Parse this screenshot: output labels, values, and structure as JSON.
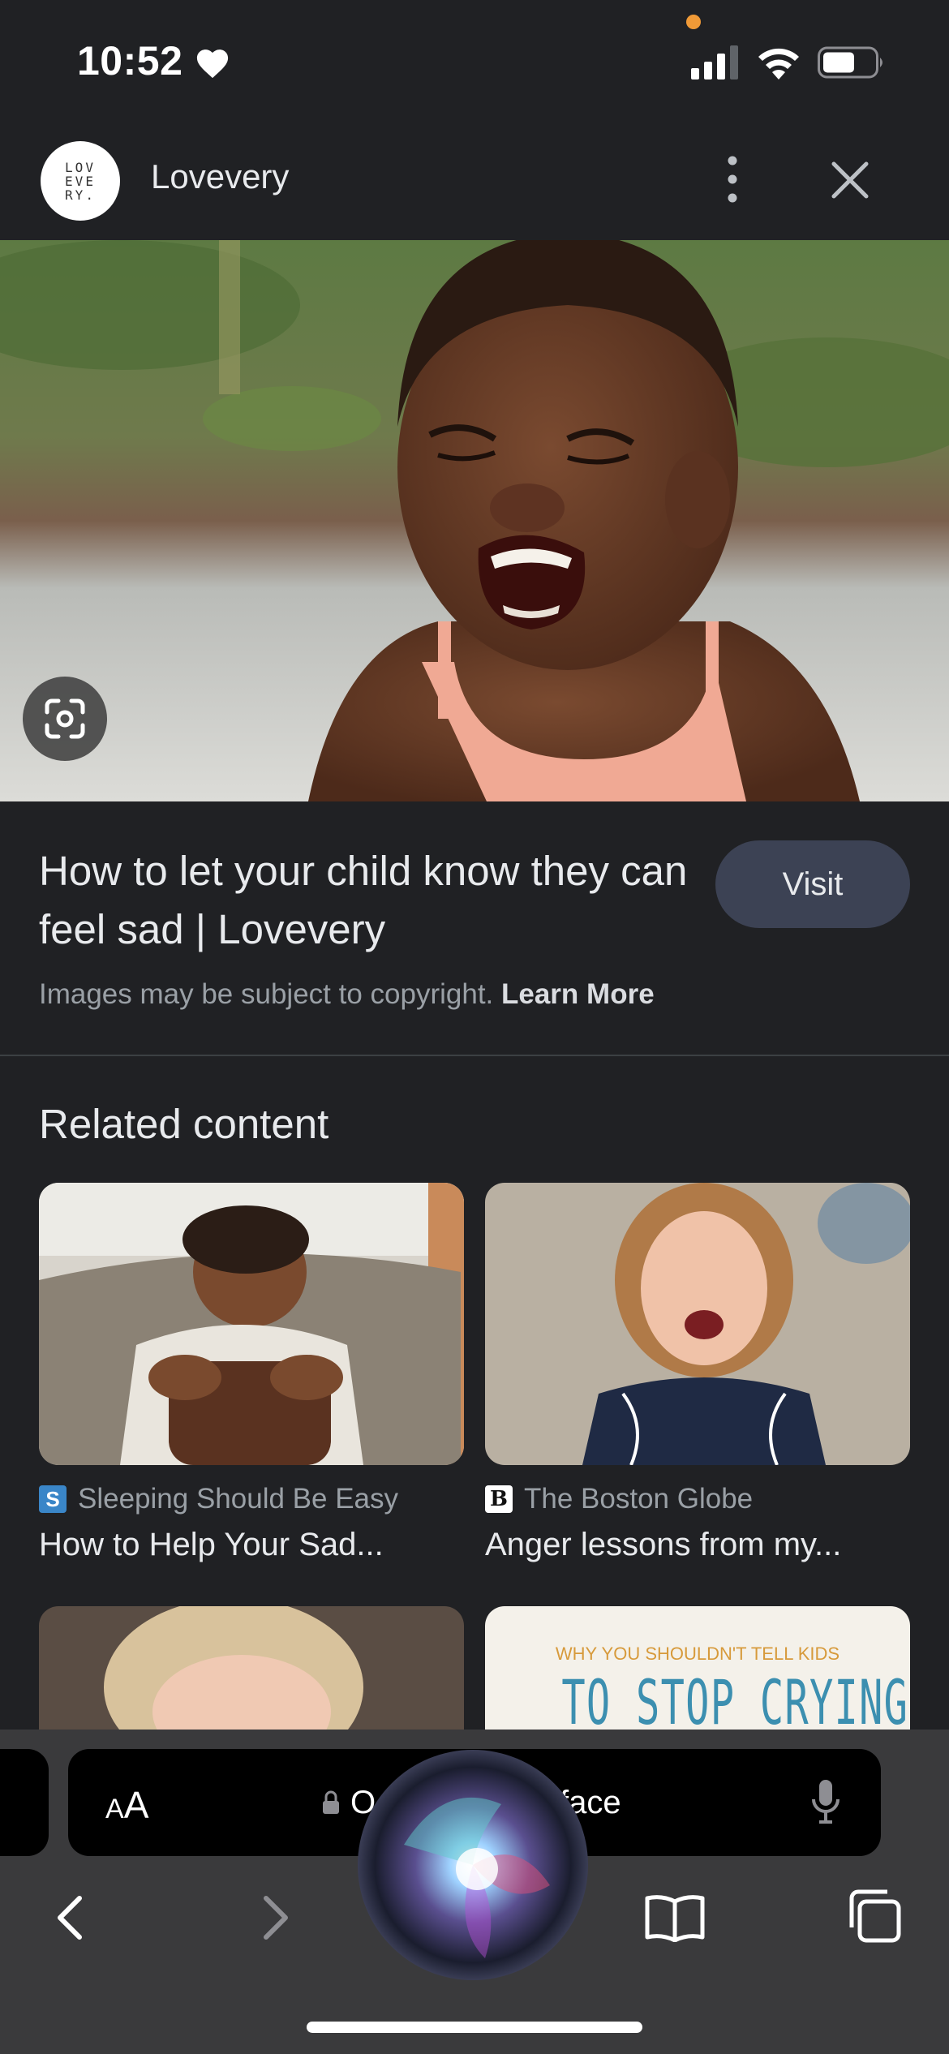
{
  "status_bar": {
    "time": "10:52"
  },
  "header": {
    "source_logo_text": "LOV\nEVE\nRY.",
    "source_name": "Lovevery"
  },
  "result": {
    "title": "How to let your child know they can feel sad | Lovevery",
    "visit_label": "Visit",
    "copyright_text": "Images may be subject to copyright. ",
    "learn_more": "Learn More"
  },
  "related": {
    "heading": "Related content",
    "cards": [
      {
        "favicon": "S",
        "source": "Sleeping Should Be Easy",
        "title": "How to Help Your Sad..."
      },
      {
        "favicon": "B",
        "source": "The Boston Globe",
        "title": "Anger lessons from my..."
      }
    ],
    "partial_card_caption_line1": "WHY YOU SHOULDN'T TELL KIDS",
    "partial_card_caption_line2": "TO STOP CRYING"
  },
  "browser": {
    "aa_label_small": "A",
    "aa_label_large": "A",
    "address_left": "O",
    "address_right": "face"
  },
  "colors": {
    "background": "#202124",
    "visit_button": "#3c4254",
    "toolbar": "#3a3a3c"
  }
}
